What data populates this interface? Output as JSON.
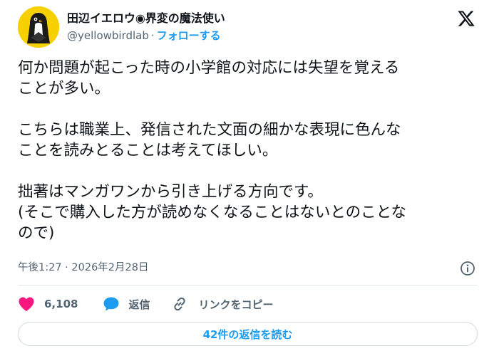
{
  "header": {
    "display_name": "田辺イエロウ◉界変の魔法使い",
    "handle": "@yellowbirdlab",
    "separator": "·",
    "follow_label": "フォローする",
    "logo_icon": "x-logo-icon",
    "avatar_icon": "penguin-avatar-icon"
  },
  "tweet": {
    "lines": [
      "何か問題が起こった時の小学館の対応には失望を覚える",
      "ことが多い。",
      "",
      "こちらは職業上、発信された文面の細かな表現に色んな",
      "ことを読みとることは考えてほしい。",
      "",
      "拙著はマンガワンから引き上げる方向です。",
      "(そこで購入した方が読めなくなることはないとのことな",
      "ので)"
    ],
    "timestamp": "午後1:27 · 2026年2月28日"
  },
  "actions": {
    "like_count": "6,108",
    "reply_label": "返信",
    "copy_link_label": "リンクをコピー",
    "like_icon": "heart-icon",
    "reply_icon": "speech-bubble-icon",
    "copy_icon": "link-icon",
    "info_icon": "info-icon"
  },
  "footer": {
    "read_replies_label": "42件の返信を読む"
  },
  "colors": {
    "accent": "#1d9bf0",
    "like": "#f91880",
    "text": "#0f1419",
    "muted": "#536471",
    "avatar_bg": "#f6d000"
  }
}
